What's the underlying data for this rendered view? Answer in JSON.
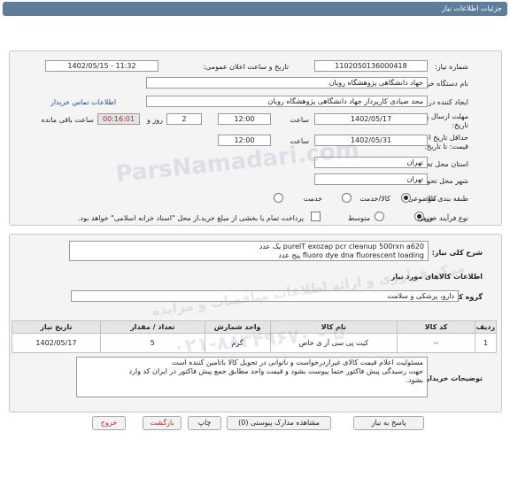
{
  "titlebar": {
    "title": "جزئیات اطلاعات نیاز"
  },
  "form": {
    "need_number": {
      "label": "شماره نیاز:",
      "value": "1102050136000418"
    },
    "announce_datetime": {
      "label": "تاریخ و ساعت اعلان عمومی:",
      "value": "1402/05/15 - 11:32"
    },
    "buyer_org": {
      "label": "نام دستگاه خریدار:",
      "value": "جهاد دانشگاهی پژوهشگاه رویان"
    },
    "requester": {
      "label": "ایجاد کننده درخواست:",
      "value": "مجد صیادی کارپرداز جهاد دانشگاهی پژوهشگاه رویان"
    },
    "buyer_contact_link": "اطلاعات تماس خریدار",
    "reply_deadline": {
      "label_line1": "مهلت ارسال پاسخ: تا",
      "label_line2": "تاریخ:",
      "date": "1402/05/17",
      "time_label": "ساعت",
      "time": "12:00",
      "days_label": "روز و",
      "days": "2",
      "timer": "00:16:01",
      "remaining_label": "ساعت باقی مانده"
    },
    "price_validity": {
      "label_line1": "حداقل تاریخ اعتبار",
      "label_line2": "قیمت: تا تاریخ:",
      "date": "1402/05/31",
      "time_label": "ساعت",
      "time": "12:00"
    },
    "province": {
      "label": "استان محل تحویل:",
      "value": "تهران"
    },
    "city": {
      "label": "شهر محل تحویل:",
      "value": "تهران"
    },
    "category": {
      "label": "طبقه بندی موضوعی:",
      "options": [
        "کالا",
        "کالا/خدمت",
        "خدمت"
      ],
      "selected": "کالا"
    },
    "purchase_process": {
      "label": "نوع فرآیند خرید :",
      "options": [
        "جزیی",
        "متوسط"
      ],
      "selected": "جزیی",
      "note": "پرداخت تمام یا بخشی از مبلغ خرید،از محل \"اسناد خزانه اسلامی\" خواهد بود."
    }
  },
  "details": {
    "summary_label": "شرح کلی نیاز:",
    "summary_lines": [
      "pureIT exozap pcr cleanup 500rxn a620 یک عدد",
      "fluoro dye dna fluorescent loading پنج عدد"
    ],
    "items_heading": "اطلاعات کالاهای مورد نیاز",
    "goods_group_label": "گروه کالا:",
    "goods_group": "دارو، پزشکی و سلامت",
    "table": {
      "headers": [
        "ردیف",
        "کد کالا",
        "نام کالا",
        "واحد شمارش",
        "تعداد / مقدار",
        "تاریخ نیاز"
      ],
      "rows": [
        [
          "1",
          "--",
          "کیت پی سی آر ی خاص",
          "گرم",
          "5",
          "1402/05/17"
        ]
      ]
    },
    "buyer_notes_label": "توضیحات خریدار:",
    "buyer_notes_lines": [
      "مسئولیت اعلام قیمت کالای غیرازدرخواست و ناتوانی در تحویل کالا باتامین کننده است",
      "جهت رسیدگی پیش فاکتور حتما پیوست بشود و قیمت واحد مطابق جمع پیش فاکتور در ایران کد وارد",
      "بشود."
    ]
  },
  "actions": {
    "reply": "پاسخ به نیاز",
    "attachments": "مشاهده مدارک پیوستی (0)",
    "print": "چاپ",
    "back": "بازگشت",
    "exit": "خروج"
  },
  "watermark": {
    "brand": "ParsNamadari.com",
    "tagline": "مرکز فرآوری و ارائه اطلاعات مناقصات و مزایده",
    "phone": "۰۲۱-۸۸۳۴۹۶۷۰ - ۵"
  }
}
